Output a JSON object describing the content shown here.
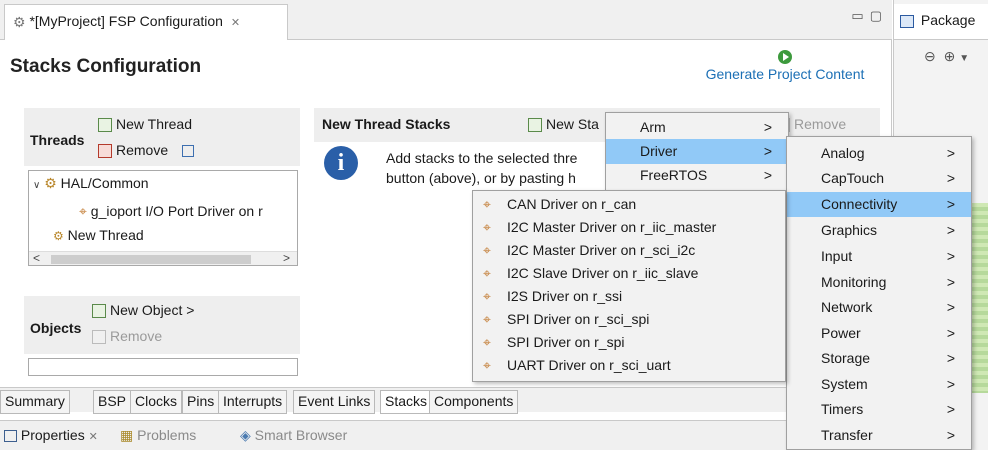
{
  "editor_tab": {
    "title": "*[MyProject] FSP Configuration",
    "close": "✕"
  },
  "right_view": {
    "title": "Package"
  },
  "main": {
    "title": "Stacks Configuration",
    "generate_label": "Generate Project Content"
  },
  "threads": {
    "label": "Threads",
    "new_thread": "New Thread",
    "remove": "Remove",
    "tree": {
      "root": "HAL/Common",
      "child": "g_ioport I/O Port Driver on r",
      "item2": "New Thread"
    }
  },
  "objects": {
    "label": "Objects",
    "new_object": "New Object >",
    "remove": "Remove"
  },
  "thread_stacks": {
    "title": "New Thread Stacks",
    "new_stack": "New Sta",
    "remove": "Remove",
    "info_line1": "Add stacks to the selected thre",
    "info_line2": "button (above), or by pasting h"
  },
  "menu_level1": [
    "Arm",
    "Driver",
    "FreeRTOS"
  ],
  "menu_level2": [
    "Analog",
    "CapTouch",
    "Connectivity",
    "Graphics",
    "Input",
    "Monitoring",
    "Network",
    "Power",
    "Storage",
    "System",
    "Timers",
    "Transfer"
  ],
  "menu_level3": [
    "CAN Driver on r_can",
    "I2C Master Driver on r_iic_master",
    "I2C Master Driver on r_sci_i2c",
    "I2C Slave Driver on r_iic_slave",
    "I2S Driver on r_ssi",
    "SPI Driver on r_sci_spi",
    "SPI Driver on r_spi",
    "UART Driver on r_sci_uart"
  ],
  "bottom_tabs": [
    "Summary",
    "BSP",
    "Clocks",
    "Pins",
    "Interrupts",
    "Event Links",
    "Stacks",
    "Components"
  ],
  "bottom_views": {
    "properties": "Properties",
    "problems": "Problems",
    "smart_browser": "Smart Browser"
  },
  "colors": {
    "selection": "#91c9f7",
    "link": "#1b6fb5",
    "info": "#2a5fa8"
  }
}
